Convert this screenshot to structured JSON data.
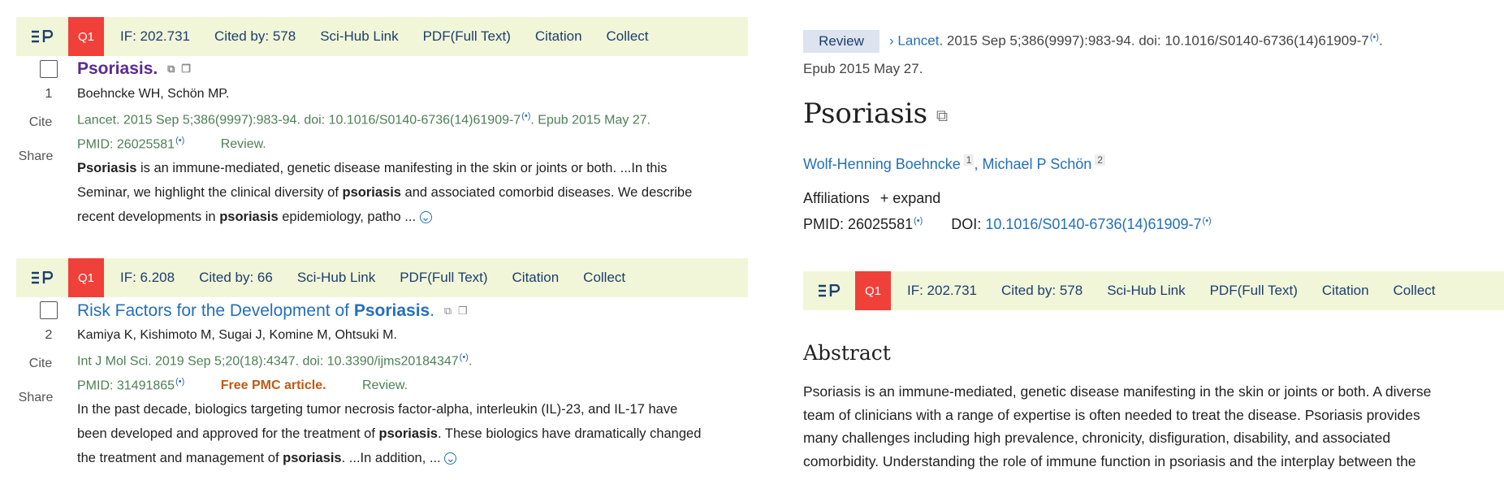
{
  "bar_left_1": {
    "q1": "Q1",
    "if": "IF: 202.731",
    "cited": "Cited by: 578",
    "scihub": "Sci-Hub Link",
    "pdf": "PDF(Full Text)",
    "citation": "Citation",
    "collect": "Collect"
  },
  "bar_left_2": {
    "q1": "Q1",
    "if": "IF: 6.208",
    "cited": "Cited by: 66",
    "scihub": "Sci-Hub Link",
    "pdf": "PDF(Full Text)",
    "citation": "Citation",
    "collect": "Collect"
  },
  "bar_right": {
    "q1": "Q1",
    "if": "IF: 202.731",
    "cited": "Cited by: 578",
    "scihub": "Sci-Hub Link",
    "pdf": "PDF(Full Text)",
    "citation": "Citation",
    "collect": "Collect"
  },
  "side": {
    "cite": "Cite",
    "share": "Share"
  },
  "results": [
    {
      "number": "1",
      "title": "Psoriasis.",
      "authors": "Boehncke WH, Schön MP.",
      "citation": "Lancet. 2015 Sep 5;386(9997):983-94. doi: 10.1016/S0140-6736(14)61909-7",
      "epub": ". Epub 2015 May 27.",
      "pmid": "PMID: 26025581",
      "review": "Review.",
      "snippet_1a": "Psoriasis",
      "snippet_1b": " is an immune-mediated, genetic disease manifesting in the skin or joints or both. ...In this",
      "snippet_2a": "Seminar, we highlight the clinical diversity of ",
      "snippet_2b": "psoriasis",
      "snippet_2c": " and associated comorbid diseases. We describe",
      "snippet_3a": "recent developments in ",
      "snippet_3b": "psoriasis",
      "snippet_3c": " epidemiology, patho ..."
    },
    {
      "number": "2",
      "title_a": "Risk Factors for the Development of ",
      "title_b": "Psoriasis",
      "title_c": ".",
      "authors": "Kamiya K, Kishimoto M, Sugai J, Komine M, Ohtsuki M.",
      "citation": "Int J Mol Sci. 2019 Sep 5;20(18):4347. doi: 10.3390/ijms20184347",
      "citation_end": ".",
      "pmid": "PMID: 31491865",
      "free": "Free PMC article.",
      "review": "Review.",
      "snippet_1": "In the past decade, biologics targeting tumor necrosis factor-alpha, interleukin (IL)-23, and IL-17 have",
      "snippet_2a": "been developed and approved for the treatment of ",
      "snippet_2b": "psoriasis",
      "snippet_2c": ". These biologics have dramatically changed",
      "snippet_3a": "the treatment and management of ",
      "snippet_3b": "psoriasis",
      "snippet_3c": ". ...In addition, ..."
    }
  ],
  "detail": {
    "badge": "Review",
    "journal": "Lancet",
    "citation": ". 2015 Sep 5;386(9997):983-94. doi: 10.1016/S0140-6736(14)61909-7",
    "citation_end": ".",
    "epub": "Epub 2015 May 27.",
    "title": "Psoriasis",
    "author1": "Wolf-Henning Boehncke",
    "author1_sup": "1",
    "sep": ", ",
    "author2": "Michael P Schön",
    "author2_sup": "2",
    "affiliations": "Affiliations",
    "expand": "+ expand",
    "pmid": "PMID: 26025581",
    "doi_label": "DOI: ",
    "doi": "10.1016/S0140-6736(14)61909-7",
    "abstract_heading": "Abstract",
    "abstract_lines": [
      "Psoriasis is an immune-mediated, genetic disease manifesting in the skin or joints or both. A diverse",
      "team of clinicians with a range of expertise is often needed to treat the disease. Psoriasis provides",
      "many challenges including high prevalence, chronicity, disfiguration, disability, and associated",
      "comorbidity. Understanding the role of immune function in psoriasis and the interplay between the"
    ]
  },
  "icons": {
    "logo": "ep-logo-icon",
    "signal": "signal-icon",
    "translate": "translate-icon",
    "copy": "copy-icon",
    "expand": "chevron-down-icon"
  },
  "colors": {
    "bar_bg": "#f2f6d8",
    "q1_bg": "#f0403a",
    "link": "#2370b8",
    "citation_green": "#4d8055",
    "free_pmc": "#c05a13",
    "title_purple": "#5b2a91"
  }
}
